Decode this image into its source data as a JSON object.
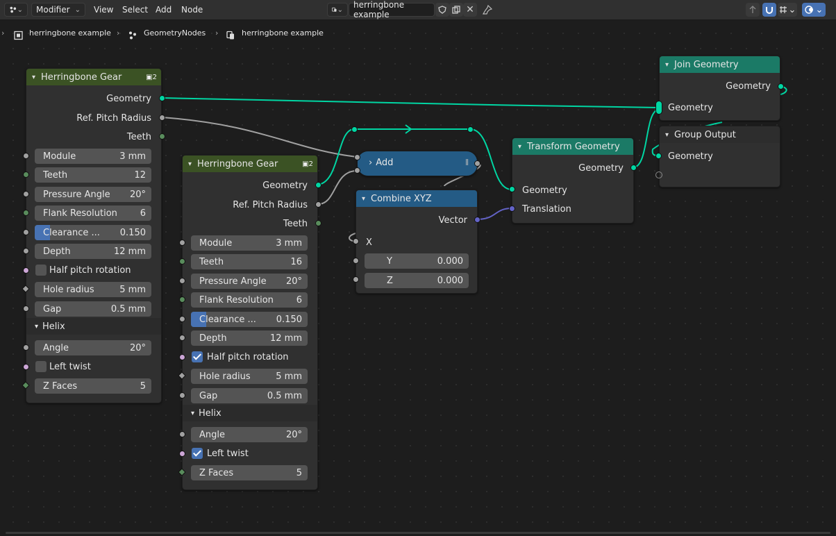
{
  "header": {
    "editor_type_icon": "node-editor-icon",
    "mode": "Modifier",
    "menus": [
      "View",
      "Select",
      "Add",
      "Node"
    ],
    "node_group_name": "herringbone example"
  },
  "breadcrumb": [
    "herringbone example",
    "GeometryNodes",
    "herringbone example"
  ],
  "colors": {
    "group": "#3b5224",
    "geometry": "#1b7a66",
    "converter": "#245b85",
    "geo_socket": "#00d6a3",
    "accent": "#4772b3"
  },
  "gear1": {
    "title": "Herringbone Gear",
    "users": "2",
    "outputs": [
      "Geometry",
      "Ref. Pitch Radius",
      "Teeth"
    ],
    "module": {
      "label": "Module",
      "value": "3 mm"
    },
    "teeth": {
      "label": "Teeth",
      "value": "12"
    },
    "pressure": {
      "label": "Pressure Angle",
      "value": "20°"
    },
    "flank": {
      "label": "Flank Resolution",
      "value": "6"
    },
    "clearance": {
      "label": "Clearance ...",
      "value": "0.150"
    },
    "depth": {
      "label": "Depth",
      "value": "12 mm"
    },
    "half_pitch": {
      "label": "Half pitch rotation",
      "checked": false
    },
    "hole": {
      "label": "Hole radius",
      "value": "5 mm"
    },
    "gap": {
      "label": "Gap",
      "value": "0.5 mm"
    },
    "panel": "Helix",
    "angle": {
      "label": "Angle",
      "value": "20°"
    },
    "left_twist": {
      "label": "Left twist",
      "checked": false
    },
    "zfaces": {
      "label": "Z Faces",
      "value": "5"
    }
  },
  "gear2": {
    "title": "Herringbone Gear",
    "users": "2",
    "outputs": [
      "Geometry",
      "Ref. Pitch Radius",
      "Teeth"
    ],
    "module": {
      "label": "Module",
      "value": "3 mm"
    },
    "teeth": {
      "label": "Teeth",
      "value": "16"
    },
    "pressure": {
      "label": "Pressure Angle",
      "value": "20°"
    },
    "flank": {
      "label": "Flank Resolution",
      "value": "6"
    },
    "clearance": {
      "label": "Clearance ...",
      "value": "0.150"
    },
    "depth": {
      "label": "Depth",
      "value": "12 mm"
    },
    "half_pitch": {
      "label": "Half pitch rotation",
      "checked": true
    },
    "hole": {
      "label": "Hole radius",
      "value": "5 mm"
    },
    "gap": {
      "label": "Gap",
      "value": "0.5 mm"
    },
    "panel": "Helix",
    "angle": {
      "label": "Angle",
      "value": "20°"
    },
    "left_twist": {
      "label": "Left twist",
      "checked": true
    },
    "zfaces": {
      "label": "Z Faces",
      "value": "5"
    }
  },
  "add": {
    "title": "Add"
  },
  "combine": {
    "title": "Combine XYZ",
    "output": "Vector",
    "x": "X",
    "y": {
      "label": "Y",
      "value": "0.000"
    },
    "z": {
      "label": "Z",
      "value": "0.000"
    }
  },
  "transform": {
    "title": "Transform Geometry",
    "output": "Geometry",
    "inputs": [
      "Geometry",
      "Translation"
    ]
  },
  "join": {
    "title": "Join Geometry",
    "output": "Geometry",
    "input": "Geometry"
  },
  "group_output": {
    "title": "Group Output",
    "input": "Geometry"
  }
}
